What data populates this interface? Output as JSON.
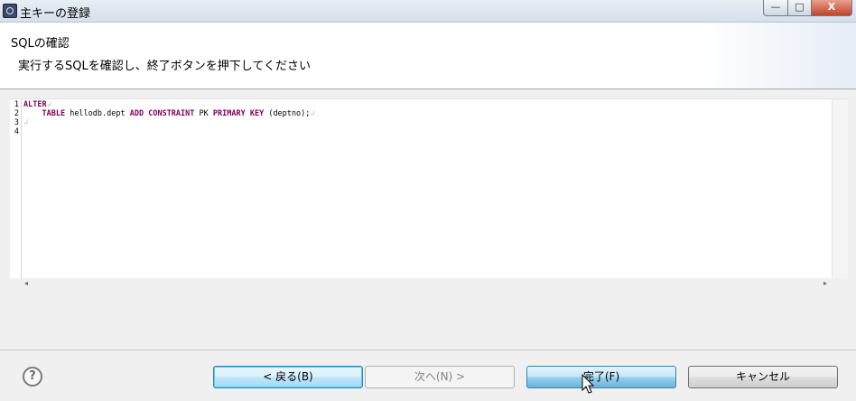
{
  "window": {
    "title": "主キーの登録",
    "icon": "eclipse-icon",
    "min_label": "—",
    "max_label": "□",
    "close_label": "X"
  },
  "header": {
    "title": "SQLの確認",
    "message": "実行するSQLを確認し、終了ボタンを押下してください"
  },
  "editor": {
    "line_numbers": [
      "1",
      "2",
      "3",
      "4"
    ],
    "lines": [
      {
        "tokens": [
          {
            "t": "ALTER",
            "kw": true
          }
        ],
        "eol": "↲"
      },
      {
        "tokens": [
          {
            "t": "    "
          },
          {
            "t": "TABLE",
            "kw": true
          },
          {
            "t": " hellodb.dept "
          },
          {
            "t": "ADD",
            "kw": true
          },
          {
            "t": " "
          },
          {
            "t": "CONSTRAINT",
            "kw": true
          },
          {
            "t": " PK "
          },
          {
            "t": "PRIMARY",
            "kw": true
          },
          {
            "t": " "
          },
          {
            "t": "KEY",
            "kw": true
          },
          {
            "t": " (deptno);"
          }
        ],
        "eol": "↲"
      },
      {
        "tokens": [],
        "eol": "↲"
      },
      {
        "tokens": [],
        "eol": ""
      }
    ],
    "scroll_left": "◂",
    "scroll_right": "▸"
  },
  "buttons": {
    "help": "?",
    "back": "< 戻る(B)",
    "next": "次へ(N) >",
    "finish": "完了(F)",
    "cancel": "キャンセル"
  },
  "colors": {
    "keyword": "#7f0055",
    "focus_border": "#3c7fb1"
  }
}
